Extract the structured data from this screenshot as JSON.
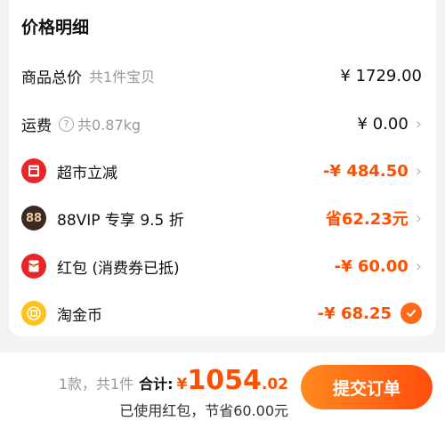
{
  "price_detail": {
    "title": "价格明细",
    "rows": [
      {
        "label": "商品总价",
        "sub": "共1件宝贝",
        "amount": "¥ 1729.00",
        "has_chevron": false
      },
      {
        "label": "运费",
        "sub": "共0.87kg",
        "sub_icon": "question-icon",
        "amount": "¥ 0.00",
        "has_chevron": true
      },
      {
        "label": "超市立减",
        "icon": "supermarket-discount-icon",
        "amount": "-¥ 484.50",
        "has_chevron": true
      },
      {
        "label": "88VIP 专享 9.5 折",
        "icon": "88vip-icon",
        "icon_text": "88",
        "amount": "省62.23元",
        "has_chevron": true
      },
      {
        "label": "红包 (消费券已抵)",
        "icon": "red-packet-icon",
        "amount": "-¥ 60.00",
        "has_chevron": true
      },
      {
        "label": "淘金币",
        "icon": "taojinbi-coin-icon",
        "amount": "-¥ 68.25",
        "checked": true
      }
    ]
  },
  "footer": {
    "count": "1款，共1件",
    "total_label": "合计:",
    "currency": "¥",
    "total_integer": "1054",
    "total_decimal": ".02",
    "note": "已使用红包，节省60.00元",
    "submit_label": "提交订单"
  },
  "colors": {
    "accent": "#ff5000",
    "button_gradient_start": "#ff8a1f",
    "button_gradient_end": "#ff4e0d",
    "red_icon": "#e8262a",
    "vip_icon": "#3a2a22",
    "coin_icon": "#ffc21a"
  }
}
